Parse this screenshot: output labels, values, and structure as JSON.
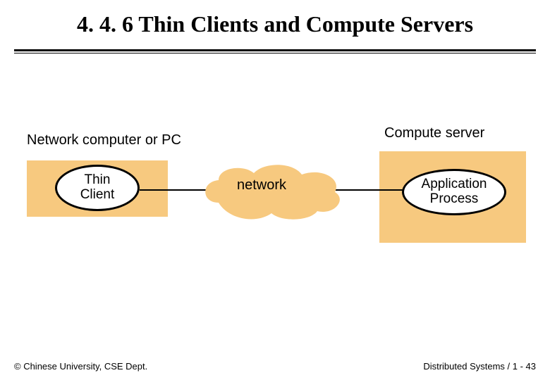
{
  "title": "4. 4. 6 Thin Clients and Compute Servers",
  "labels": {
    "left": "Network computer or PC",
    "right": "Compute server",
    "network": "network"
  },
  "nodes": {
    "thin_client": "Thin\nClient",
    "application_process": "Application\nProcess"
  },
  "footer": {
    "left": "© Chinese University, CSE Dept.",
    "right": "Distributed Systems / 1 - 43"
  },
  "colors": {
    "box_fill": "#f7c97f",
    "cloud_fill": "#f7c97f"
  }
}
